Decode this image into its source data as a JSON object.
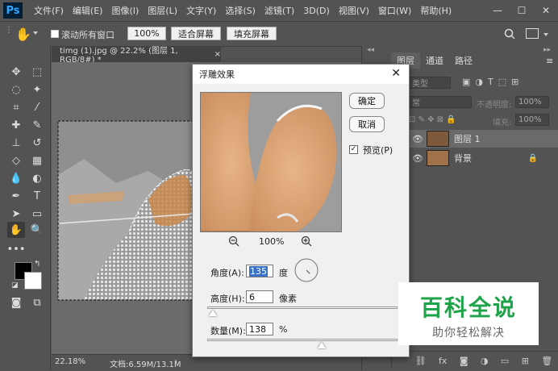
{
  "menubar": {
    "logo": "Ps",
    "items": [
      "文件(F)",
      "编辑(E)",
      "图像(I)",
      "图层(L)",
      "文字(Y)",
      "选择(S)",
      "滤镜(T)",
      "3D(D)",
      "视图(V)",
      "窗口(W)",
      "帮助(H)"
    ],
    "minimize": "—",
    "maximize": "☐",
    "close": "✕"
  },
  "optionsbar": {
    "scroll_all": "滚动所有窗口",
    "zoom_100": "100%",
    "fit_screen": "适合屏幕",
    "fill_screen": "填充屏幕"
  },
  "document": {
    "tab_title": "timg (1).jpg @ 22.2% (图层 1, RGB/8#) *",
    "tab_close": "×",
    "zoom": "22.18%",
    "doc_info": "文档:6.59M/13.1M"
  },
  "panels": {
    "tabs": [
      "图层",
      "通道",
      "路径"
    ],
    "kind": "类型",
    "blend": "常",
    "opacity_label": "不透明度:",
    "opacity_value": "100%",
    "fill_label": "填充:",
    "fill_value": "100%",
    "layers": [
      {
        "name": "图层 1"
      },
      {
        "name": "背景"
      }
    ]
  },
  "dialog": {
    "title": "浮雕效果",
    "ok": "确定",
    "cancel": "取消",
    "preview_label": "预览(P)",
    "preview_zoom": "100%",
    "angle_label": "角度(A):",
    "angle_value": "135",
    "angle_unit": "度",
    "height_label": "高度(H):",
    "height_value": "6",
    "height_unit": "像素",
    "height_slider": 0.03,
    "amount_label": "数量(M):",
    "amount_value": "138",
    "amount_unit": "%",
    "amount_slider": 0.6
  },
  "watermark": {
    "title": "百科全说",
    "subtitle": "助你轻松解决"
  },
  "colors": {
    "accent_green": "#1fa34a",
    "ps_blue": "#31a8ff"
  }
}
